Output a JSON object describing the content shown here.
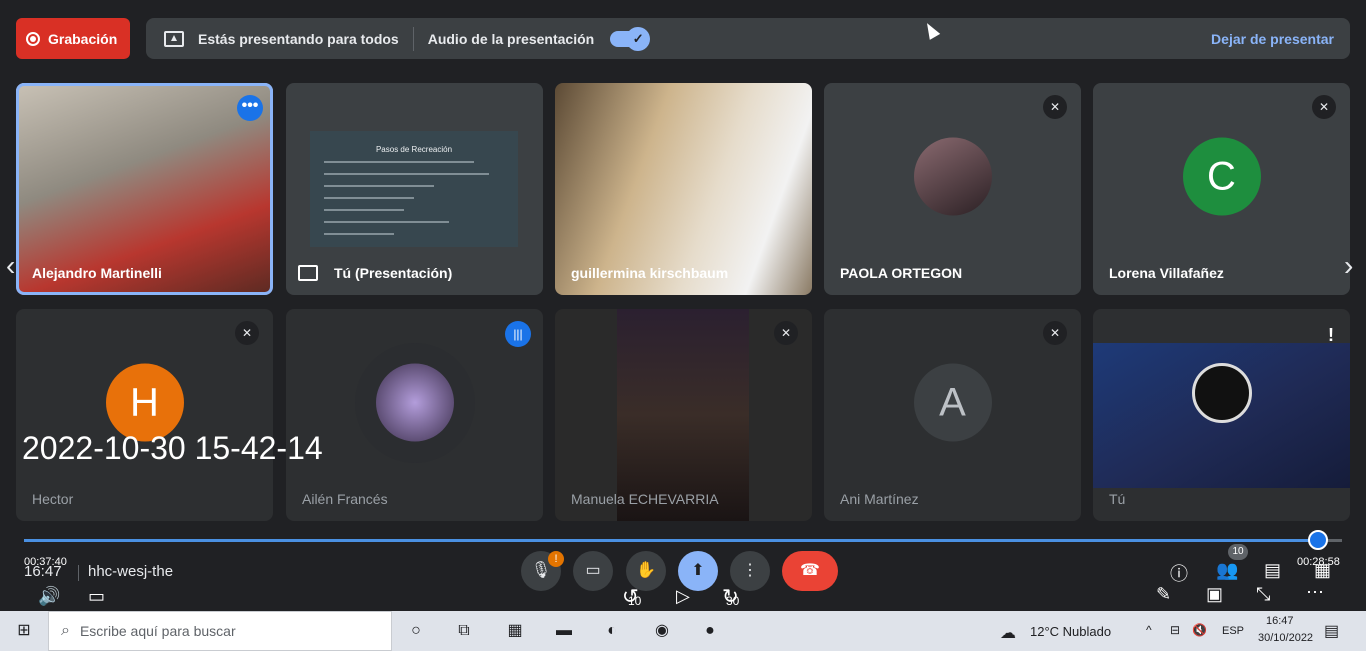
{
  "topbar": {
    "record_label": "Grabación",
    "presenting_text": "Estás presentando para todos",
    "audio_text": "Audio de la presentación",
    "toggle_check": "✓",
    "stop_label": "Dejar de presentar"
  },
  "tiles": [
    {
      "name": "Alejandro Martinelli",
      "kind": "video",
      "more": "•••"
    },
    {
      "name": "Tú (Presentación)",
      "kind": "presentation",
      "slide_title": "Pasos de Recreación"
    },
    {
      "name": "guillermina kirschbaum",
      "kind": "video"
    },
    {
      "name": "PAOLA ORTEGON",
      "kind": "avatar-photo",
      "muted": true
    },
    {
      "name": "Lorena Villafañez",
      "kind": "avatar-letter",
      "letter": "C",
      "color": "#1e8e3e",
      "muted": true
    },
    {
      "name": "Hector",
      "kind": "avatar-letter",
      "letter": "H",
      "color": "#e8710a",
      "muted": true
    },
    {
      "name": "Ailén Francés",
      "kind": "avatar-photo",
      "speaking": true
    },
    {
      "name": "Manuela ECHEVARRIA",
      "kind": "video",
      "muted": true
    },
    {
      "name": "Ani Martínez",
      "kind": "avatar-letter",
      "letter": "A",
      "color": "#3c4043",
      "muted": true
    },
    {
      "name": "Tú",
      "kind": "obs",
      "alert": "!"
    }
  ],
  "nav": {
    "prev": "‹",
    "next": "›"
  },
  "watermark": "2022-10-30 15-42-14",
  "player": {
    "elapsed": "00:37:40",
    "remaining": "00:28:58",
    "progress_fraction": 0.98,
    "rewind_label": "10",
    "forward_label": "30"
  },
  "meet": {
    "time": "16:47",
    "code": "hhc-wesj-the",
    "mic_alert": "!",
    "people_count": "10"
  },
  "taskbar": {
    "search_placeholder": "Escribe aquí para buscar",
    "weather": "12°C  Nublado",
    "lang": "ESP",
    "clock_time": "16:47",
    "clock_date": "30/10/2022"
  },
  "colors": {
    "accent": "#8ab4f8",
    "record_red": "#d93025",
    "end_call": "#ea4335",
    "background": "#202124",
    "tile": "#3c4043"
  }
}
